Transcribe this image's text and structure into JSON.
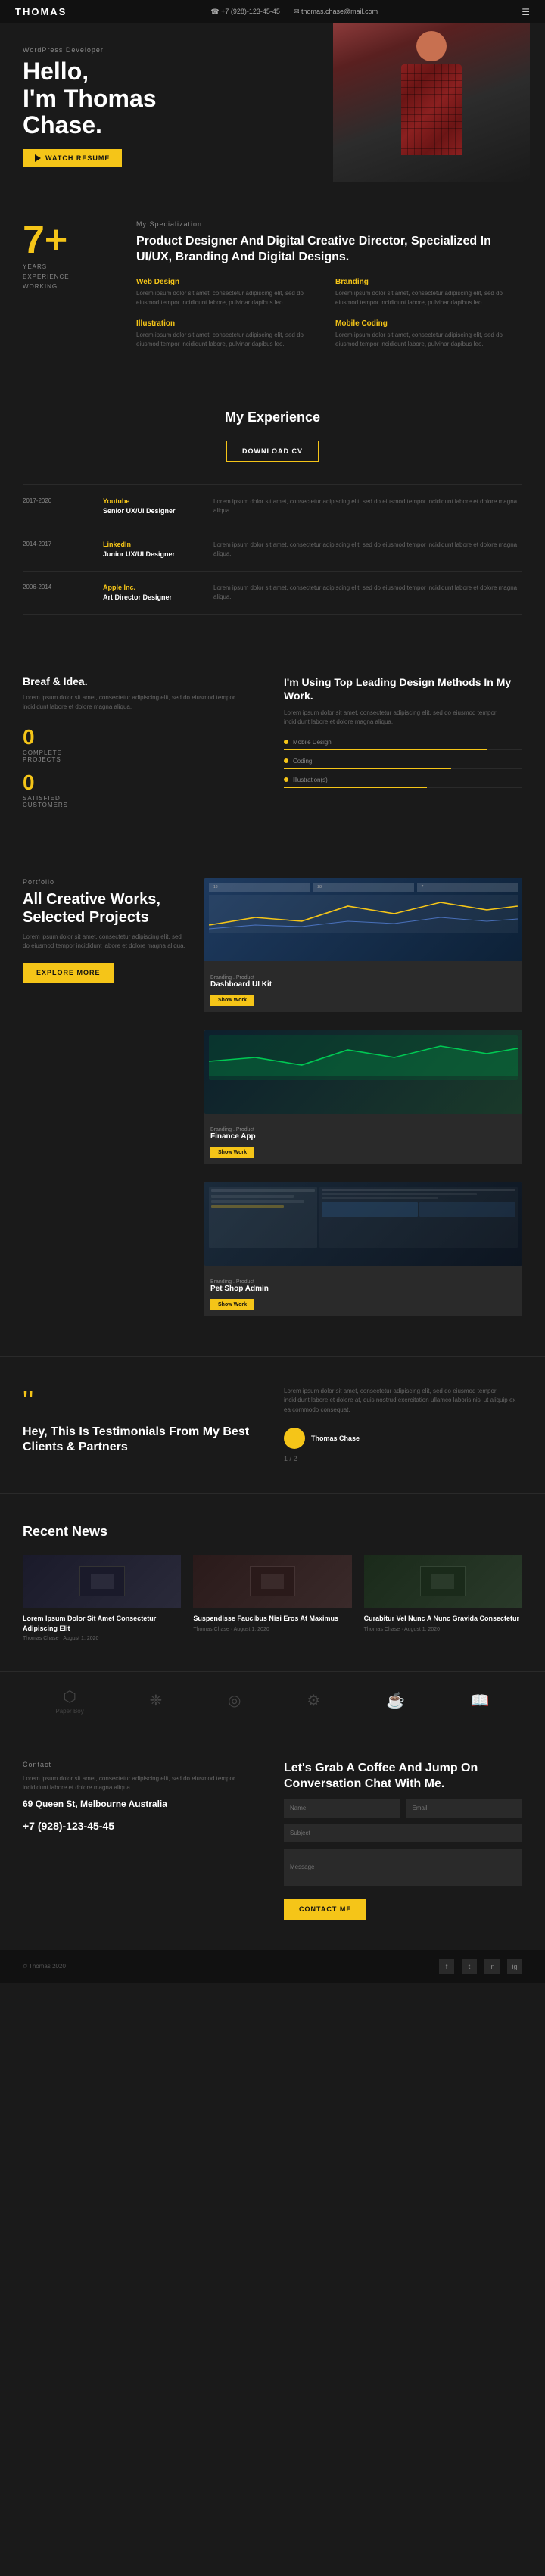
{
  "header": {
    "logo": "THOMAS",
    "phone": "☎ +7 (928)-123-45-45",
    "email": "✉ thomas.chase@mail.com",
    "menu_icon": "☰"
  },
  "hero": {
    "badge": "WordPress Developer",
    "title_line1": "Hello,",
    "title_line2": "I'm Thomas",
    "title_line3": "Chase.",
    "button_label": "WATCH RESUME"
  },
  "specialization": {
    "label": "My Specialization",
    "years_num": "7+",
    "years_line1": "YEARS",
    "years_line2": "EXPERIENCE",
    "years_line3": "WORKING",
    "title": "Product Designer And Digital Creative Director, Specialized In UI/UX, Branding And Digital Designs.",
    "cols": [
      {
        "title": "Web Design",
        "text": "Lorem ipsum dolor sit amet, consectetur adipiscing elit, sed do eiusmod tempor incididunt labore, pulvinar dapibus leo."
      },
      {
        "title": "Branding",
        "text": "Lorem ipsum dolor sit amet, consectetur adipiscing elit, sed do eiusmod tempor incididunt labore, pulvinar dapibus leo."
      },
      {
        "title": "Illustration",
        "text": "Lorem ipsum dolor sit amet, consectetur adipiscing elit, sed do eiusmod tempor incididunt labore, pulvinar dapibus leo."
      },
      {
        "title": "Mobile Coding",
        "text": "Lorem ipsum dolor sit amet, consectetur adipiscing elit, sed do eiusmod tempor incididunt labore, pulvinar dapibus leo."
      }
    ]
  },
  "experience": {
    "section_title": "My Experience",
    "download_label": "DOWNLOAD CV",
    "items": [
      {
        "date": "2017-2020",
        "company": "Youtube",
        "role": "Senior UX/UI Designer",
        "desc": "Lorem ipsum dolor sit amet, consectetur adipiscing elit, sed do eiusmod tempor incididunt labore et dolore magna aliqua."
      },
      {
        "date": "2014-2017",
        "company": "LinkedIn",
        "role": "Junior UX/UI Designer",
        "desc": "Lorem ipsum dolor sit amet, consectetur adipiscing elit, sed do eiusmod tempor incididunt labore et dolore magna aliqua."
      },
      {
        "date": "2006-2014",
        "company": "Apple Inc.",
        "role": "Art Director Designer",
        "desc": "Lorem ipsum dolor sit amet, consectetur adipiscing elit, sed do eiusmod tempor incididunt labore et dolore magna aliqua."
      }
    ]
  },
  "breaf": {
    "title": "Breaf & Idea.",
    "text": "Lorem ipsum dolor sit amet, consectetur adipiscing elit, sed do eiusmod tempor incididunt labore et dolore magna aliqua.",
    "stats": [
      {
        "num": "0",
        "label": "COMPLETE\nPROJECTS"
      },
      {
        "num": "0",
        "label": "SATISFIED\nCUSTOMERS"
      }
    ],
    "right_title": "I'm Using Top Leading Design Methods In My Work.",
    "right_text": "Lorem ipsum dolor sit amet, consectetur adipiscing elit, sed do eiusmod tempor incididunt labore et dolore magna aliqua.",
    "skills": [
      {
        "label": "Mobile Design",
        "percent": 85
      },
      {
        "label": "Coding",
        "percent": 70
      },
      {
        "label": "Illustration(s)",
        "percent": 60
      }
    ]
  },
  "portfolio": {
    "label": "Portfolio",
    "title": "All Creative Works, Selected Projects",
    "text": "Lorem ipsum dolor sit amet, consectetur adipiscing elit, sed do eiusmod tempor incididunt labore et dolore magna aliqua.",
    "explore_label": "EXPLORE MORE",
    "cards": [
      {
        "title": "Dashboard UI Kit",
        "tag": "Branding . Product",
        "show_label": "Show Work"
      },
      {
        "title": "Finance App",
        "tag": "Branding . Product",
        "show_label": "Show Work"
      },
      {
        "title": "Pet Shop Admin",
        "tag": "Branding . Product",
        "show_label": "Show Work"
      }
    ]
  },
  "testimonials": {
    "title": "Hey, This Is Testimonials From My Best Clients & Partners",
    "text": "Lorem ipsum dolor sit amet, consectetur adipiscing elit, sed do eiusmod tempor incididunt labore et dolore at, quis nostrud exercitation ullamco laboris nisi ut aliquip ex ea commodo consequat.",
    "author": "Thomas Chase",
    "pagination": "1 / 2"
  },
  "news": {
    "section_title": "Recent News",
    "items": [
      {
        "title": "Lorem Ipsum Dolor Sit Amet Consectetur Adipiscing Elit",
        "author": "Thomas Chase",
        "date": "August 1, 2020"
      },
      {
        "title": "Suspendisse Faucibus Nisi Eros At Maximus",
        "author": "Thomas Chase",
        "date": "August 1, 2020"
      },
      {
        "title": "Curabitur Vel Nunc A Nunc Gravida Consectetur",
        "author": "Thomas Chase",
        "date": "August 1, 2020"
      }
    ]
  },
  "brands": [
    {
      "icon": "⬡",
      "name": "Paper Boy"
    },
    {
      "icon": "❈",
      "name": ""
    },
    {
      "icon": "◎",
      "name": ""
    },
    {
      "icon": "⚙",
      "name": ""
    },
    {
      "icon": "☕",
      "name": ""
    },
    {
      "icon": "📖",
      "name": ""
    }
  ],
  "contact": {
    "label": "Contact",
    "address": "69 Queen St, Melbourne Australia",
    "phone": "+7 (928)-123-45-45",
    "text": "Lorem ipsum dolor sit amet, consectetur adipiscing elit, sed do eiusmod tempor incididunt labore et dolore magna aliqua.",
    "right_title": "Let's Grab A Coffee And Jump On Conversation Chat With Me.",
    "form": {
      "name_placeholder": "Name",
      "email_placeholder": "Email",
      "subject_placeholder": "Subject",
      "message_placeholder": "Message",
      "button_label": "CONTACT ME"
    }
  },
  "footer": {
    "copyright": "© Thomas 2020",
    "social": [
      "f",
      "t",
      "in",
      "ig"
    ]
  }
}
